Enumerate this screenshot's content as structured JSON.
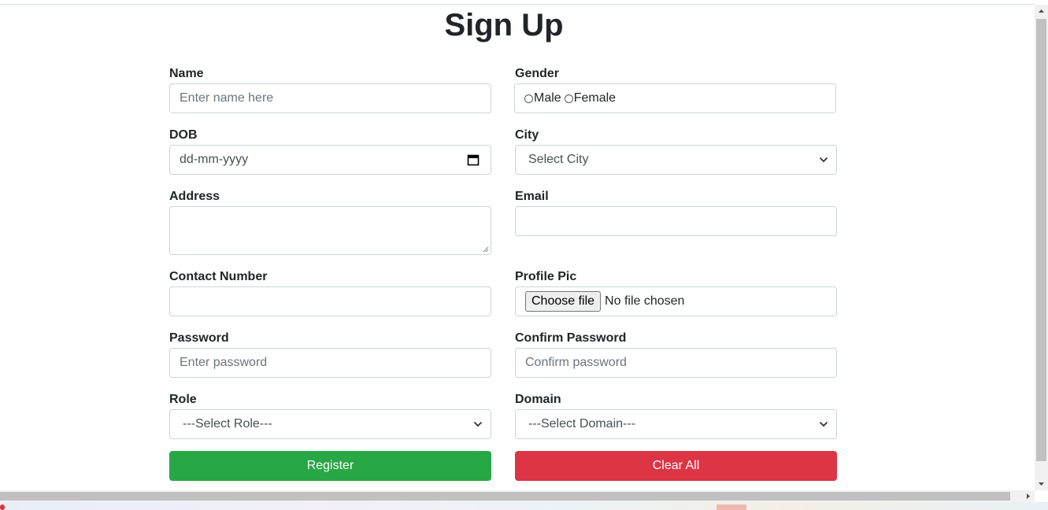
{
  "page": {
    "title": "Sign Up"
  },
  "form": {
    "name": {
      "label": "Name",
      "placeholder": "Enter name here"
    },
    "gender": {
      "label": "Gender",
      "options": [
        "Male",
        "Female"
      ]
    },
    "dob": {
      "label": "DOB",
      "value": "dd-mm-yyyy"
    },
    "city": {
      "label": "City",
      "selected": "Select City"
    },
    "address": {
      "label": "Address",
      "value": ""
    },
    "email": {
      "label": "Email",
      "value": ""
    },
    "contact": {
      "label": "Contact Number",
      "value": ""
    },
    "profile_pic": {
      "label": "Profile Pic",
      "button": "Choose file",
      "status": "No file chosen"
    },
    "password": {
      "label": "Password",
      "placeholder": "Enter password"
    },
    "confirm_password": {
      "label": "Confirm Password",
      "placeholder": "Confirm password"
    },
    "role": {
      "label": "Role",
      "selected": "---Select Role---"
    },
    "domain": {
      "label": "Domain",
      "selected": "---Select Domain---"
    }
  },
  "actions": {
    "register": "Register",
    "clear": "Clear All"
  },
  "colors": {
    "register": "#28a745",
    "clear": "#dc3545",
    "border": "#ced4da"
  },
  "icons": {
    "calendar": "calendar-icon",
    "dropdown": "chevron-down-icon"
  }
}
